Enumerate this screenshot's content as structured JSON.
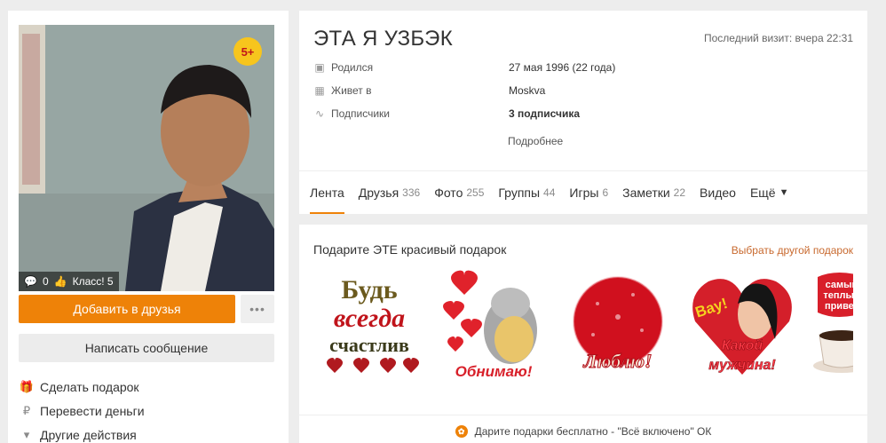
{
  "profile": {
    "name": "ЭТА Я УЗБЭК",
    "last_visit": "Последний визит: вчера 22:31",
    "age_badge": "5+",
    "photo_comments": "0",
    "photo_likes": "Класс! 5",
    "info": [
      {
        "icon": "calendar-icon",
        "label": "Родился",
        "value": "27 мая 1996 (22 года)",
        "bold": false
      },
      {
        "icon": "building-icon",
        "label": "Живет в",
        "value": "Moskva",
        "bold": false
      },
      {
        "icon": "rss-icon",
        "label": "Подписчики",
        "value": "3 подписчика",
        "bold": true
      }
    ],
    "more_link": "Подробнее"
  },
  "actions": {
    "add_friend": "Добавить в друзья",
    "more": "•••",
    "write_message": "Написать сообщение",
    "list": [
      {
        "icon": "gift-icon",
        "label": "Сделать подарок"
      },
      {
        "icon": "money-icon",
        "label": "Перевести деньги"
      },
      {
        "icon": "caret-icon",
        "label": "Другие действия"
      }
    ]
  },
  "tabs": [
    {
      "label": "Лента",
      "count": "",
      "active": true
    },
    {
      "label": "Друзья",
      "count": "336",
      "active": false
    },
    {
      "label": "Фото",
      "count": "255",
      "active": false
    },
    {
      "label": "Группы",
      "count": "44",
      "active": false
    },
    {
      "label": "Игры",
      "count": "6",
      "active": false
    },
    {
      "label": "Заметки",
      "count": "22",
      "active": false
    },
    {
      "label": "Видео",
      "count": "",
      "active": false
    },
    {
      "label": "Ещё",
      "count": "",
      "active": false
    }
  ],
  "gifts": {
    "title": "Подарите ЭТЕ красивый подарок",
    "choose_link": "Выбрать другой подарок",
    "items": [
      {
        "text": [
          "Будь",
          "всегда",
          "счастлив"
        ]
      },
      {
        "text": [
          "Обнимаю!"
        ]
      },
      {
        "text": [
          "Люблю!"
        ]
      },
      {
        "text": [
          "Вау!",
          "Какой",
          "мужчина!"
        ]
      },
      {
        "text": [
          "самый",
          "теплый",
          "привет"
        ]
      }
    ],
    "footer": "Дарите подарки бесплатно - \"Всё включено\" ОК"
  },
  "colors": {
    "accent_orange": "#ee8208",
    "badge_yellow": "#f7c51d",
    "link_brown": "#c8692e"
  }
}
